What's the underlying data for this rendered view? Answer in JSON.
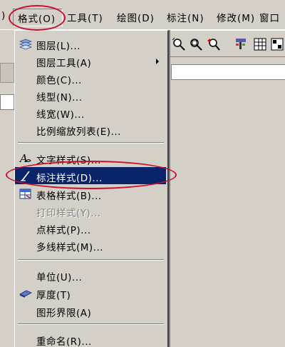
{
  "menubar": {
    "items": [
      "格式(O)",
      "工具(T)",
      "绘图(D)",
      "标注(N)",
      "修改(M)",
      "窗口"
    ],
    "leading": ")"
  },
  "menu": {
    "group1": [
      "图层(L)...",
      "图层工具(A)",
      "颜色(C)...",
      "线型(N)...",
      "线宽(W)...",
      "比例缩放列表(E)..."
    ],
    "group2": [
      "文字样式(S)...",
      "标注样式(D)...",
      "表格样式(B)...",
      "打印样式(Y)...",
      "点样式(P)...",
      "多线样式(M)..."
    ],
    "group3": [
      "单位(U)...",
      "厚度(T)",
      "图形界限(A)"
    ],
    "group4": [
      "重命名(R)..."
    ]
  },
  "colors": {
    "highlight": "#0a246a",
    "annotation": "#c8102e",
    "face": "#d4d0c8"
  },
  "icons": {
    "layer": "layers-icon",
    "text_style": "text-style-icon",
    "dim_style": "dimension-style-icon",
    "table_style": "table-style-icon",
    "thickness": "thickness-icon"
  }
}
